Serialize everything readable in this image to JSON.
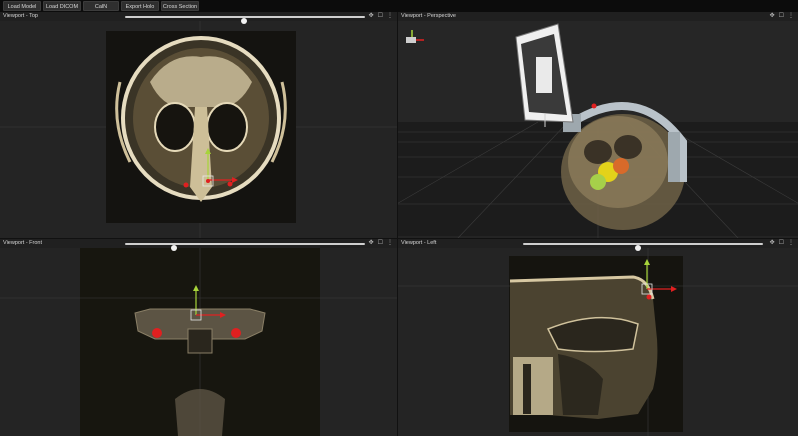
{
  "toolbar": {
    "buttons": [
      "Load Model",
      "Load DICOM",
      "CalN",
      "Export Holo",
      "Cross Section"
    ]
  },
  "viewports": {
    "top": {
      "title": "Viewport - Top",
      "slider": 0.5
    },
    "perspective": {
      "title": "Viewport - Perspective"
    },
    "front": {
      "title": "Viewport - Front",
      "slider": 0.2
    },
    "left": {
      "title": "Viewport - Left",
      "slider": 0.48
    }
  },
  "icons": {
    "move": "move-icon",
    "maximize": "maximize-icon",
    "menu": "more-vertical-icon"
  },
  "colors": {
    "bone": "#d7c8a2",
    "marker": "#e02020",
    "axis_y": "#a7d43a",
    "selection": "#6ea0d0"
  }
}
